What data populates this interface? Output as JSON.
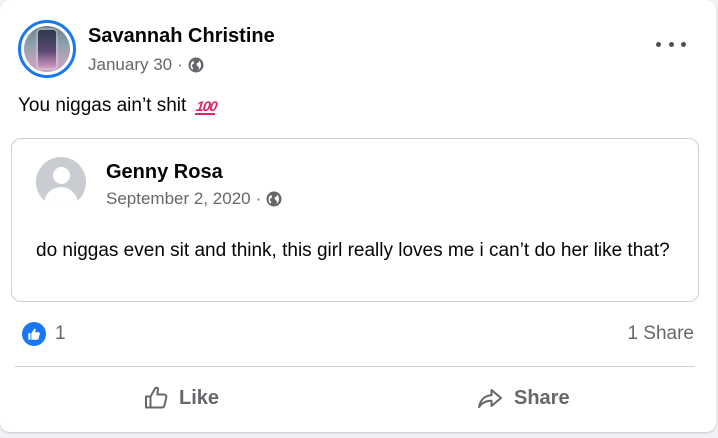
{
  "post": {
    "author": "Savannah Christine",
    "date": "January 30",
    "separator": "·",
    "text": "You niggas ain’t shit",
    "emoji": "100"
  },
  "shared_post": {
    "author": "Genny Rosa",
    "date": "September 2, 2020",
    "separator": "·",
    "text": "do niggas even sit and think, this girl really loves me i can’t do her like that?"
  },
  "reactions": {
    "like_count": "1",
    "share_count": "1 Share"
  },
  "actions": {
    "like_label": "Like",
    "share_label": "Share"
  },
  "colors": {
    "accent": "#1877f2",
    "secondary_text": "#65676b",
    "border": "#ced0d4"
  },
  "icons": {
    "privacy": "globe-icon",
    "more": "more-options-icon",
    "like": "thumbs-up-icon",
    "share": "share-arrow-icon"
  }
}
